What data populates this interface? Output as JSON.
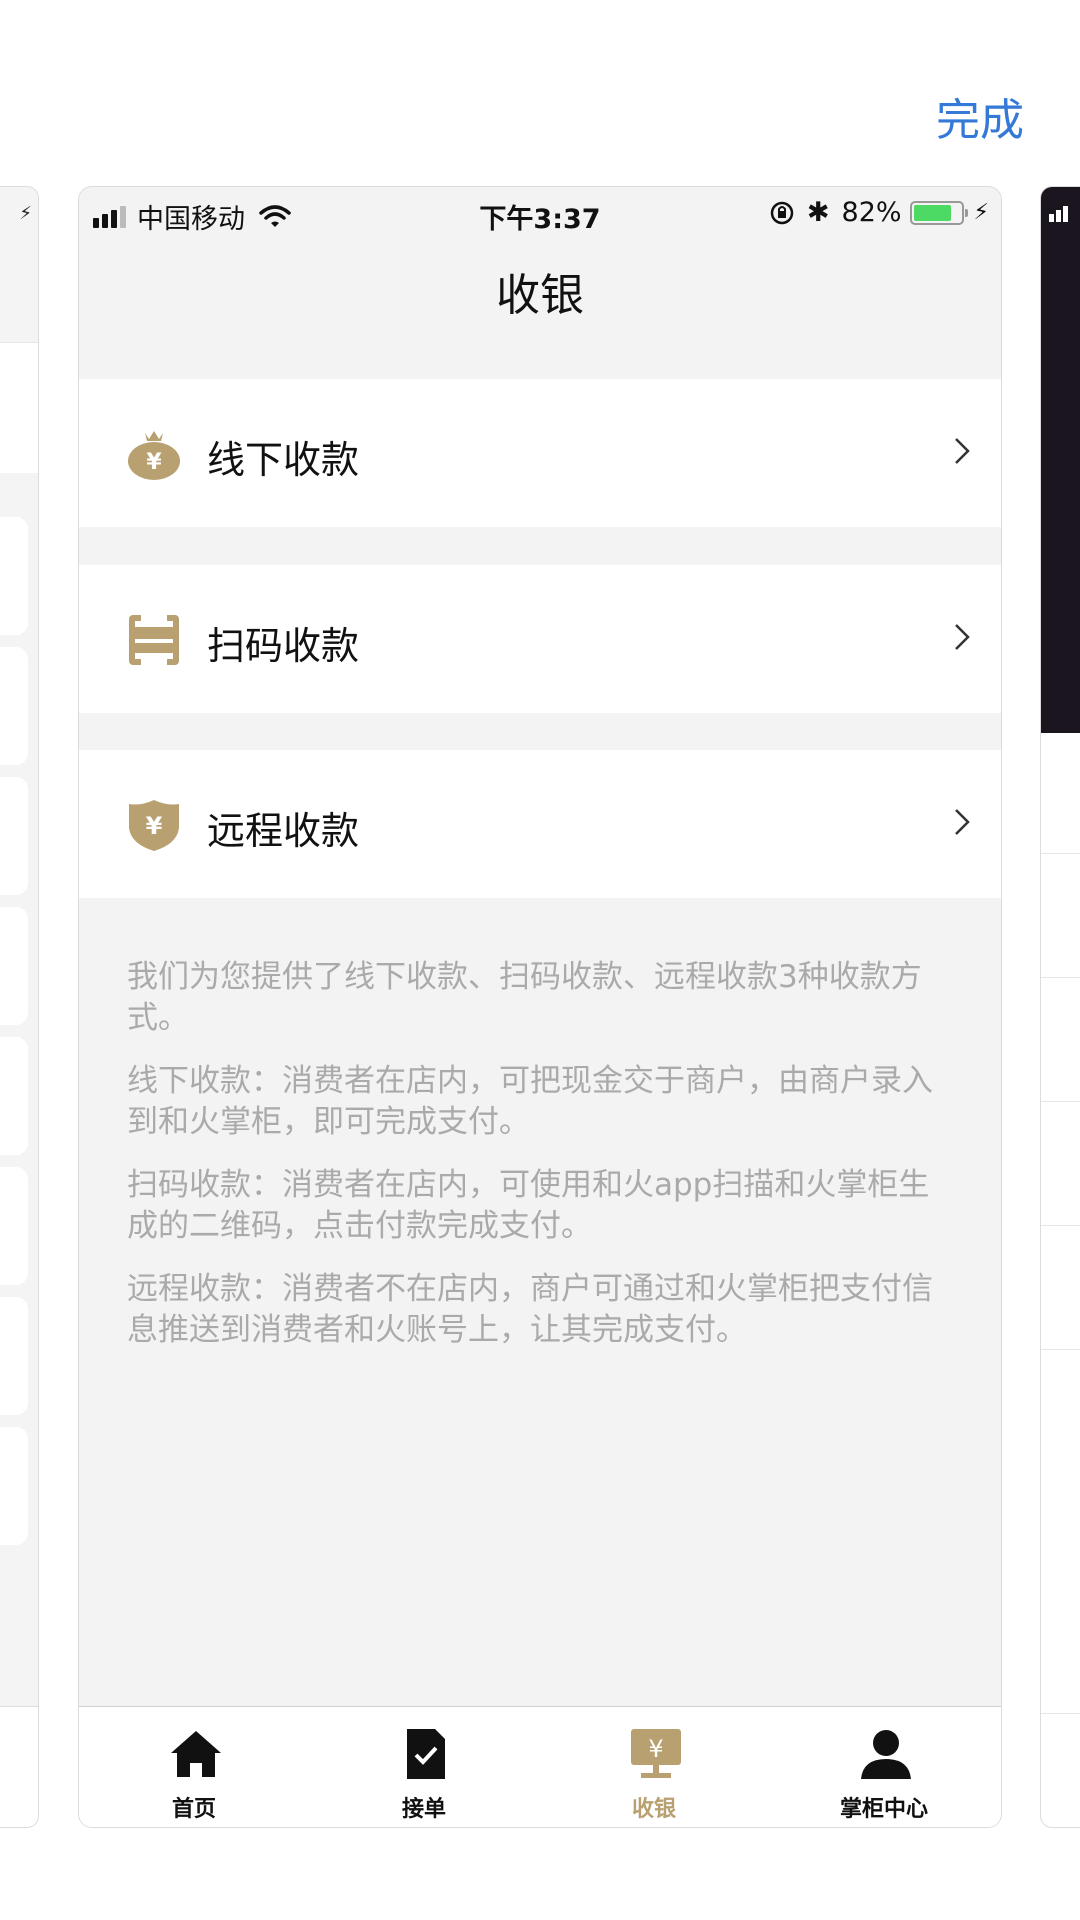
{
  "header": {
    "done_label": "完成"
  },
  "status_bar": {
    "carrier": "中国移动",
    "time": "下午3:37",
    "battery_percent": "82%",
    "battery_level": 0.82
  },
  "page": {
    "title": "收银"
  },
  "menu": [
    {
      "label": "线下收款",
      "icon": "money-bag-icon"
    },
    {
      "label": "扫码收款",
      "icon": "scan-frame-icon"
    },
    {
      "label": "远程收款",
      "icon": "shield-yen-icon"
    }
  ],
  "description": [
    "我们为您提供了线下收款、扫码收款、远程收款3种收款方式。",
    "线下收款：消费者在店内，可把现金交于商户，由商户录入到和火掌柜，即可完成支付。",
    "扫码收款：消费者在店内，可使用和火app扫描和火掌柜生成的二维码，点击付款完成支付。",
    "远程收款：消费者不在店内，商户可通过和火掌柜把支付信息推送到消费者和火账号上，让其完成支付。"
  ],
  "tabbar": {
    "items": [
      {
        "label": "首页",
        "icon": "home-icon",
        "active": false
      },
      {
        "label": "接单",
        "icon": "order-check-icon",
        "active": false
      },
      {
        "label": "收银",
        "icon": "cashier-icon",
        "active": true
      },
      {
        "label": "掌柜中心",
        "icon": "user-icon",
        "active": false
      }
    ]
  },
  "colors": {
    "accent_gold": "#b9a070",
    "done_blue": "#3478d8",
    "battery_green": "#4cd964",
    "description_gray": "#aaaaaa"
  }
}
